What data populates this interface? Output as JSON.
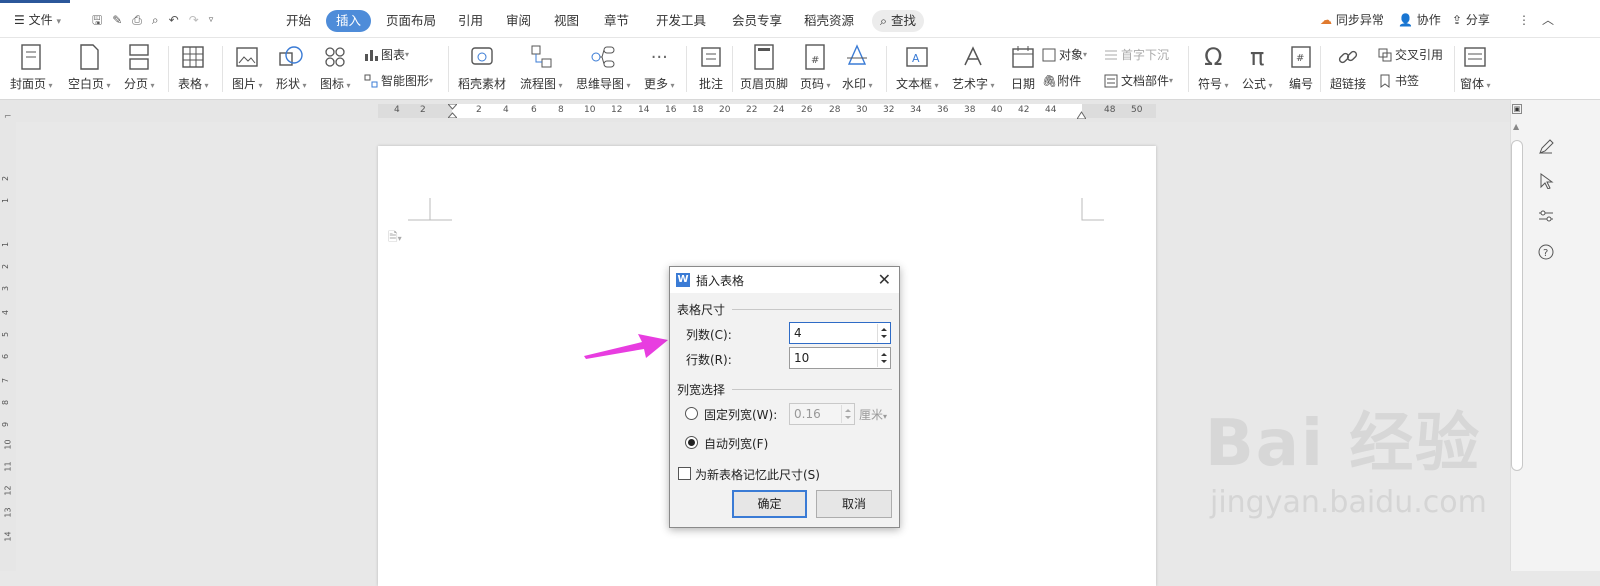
{
  "topbar": {
    "file_menu": "文件",
    "tabs": [
      "开始",
      "插入",
      "页面布局",
      "引用",
      "审阅",
      "视图",
      "章节",
      "开发工具",
      "会员专享",
      "稻壳资源"
    ],
    "search": "查找",
    "right": {
      "sync": "同步异常",
      "collab": "协作",
      "share": "分享"
    }
  },
  "ribbon": {
    "cover": "封面页",
    "blank": "空白页",
    "page_break": "分页",
    "table": "表格",
    "picture": "图片",
    "shape": "形状",
    "icon": "图标",
    "chart": "图表",
    "smart_art": "智能图形",
    "docer": "稻壳素材",
    "flowchart": "流程图",
    "mindmap": "思维导图",
    "more": "更多",
    "comment": "批注",
    "header_footer": "页眉页脚",
    "page_number": "页码",
    "watermark": "水印",
    "textbox": "文本框",
    "wordart": "艺术字",
    "date": "日期",
    "object": "对象",
    "dropcap": "首字下沉",
    "attachment": "附件",
    "doc_parts": "文档部件",
    "symbol": "符号",
    "formula": "公式",
    "numbering": "编号",
    "hyperlink": "超链接",
    "crossref": "交叉引用",
    "bookmark": "书签",
    "window": "窗体"
  },
  "ruler": {
    "h_numbers": [
      "4",
      "2",
      "2",
      "4",
      "6",
      "8",
      "10",
      "12",
      "14",
      "16",
      "18",
      "20",
      "22",
      "24",
      "26",
      "28",
      "30",
      "32",
      "34",
      "36",
      "38",
      "40",
      "42",
      "44",
      "48",
      "50"
    ],
    "v_numbers": [
      "2",
      "1",
      "1",
      "2",
      "3",
      "4",
      "5",
      "6",
      "7",
      "8",
      "9",
      "10",
      "11",
      "12",
      "13",
      "14"
    ]
  },
  "dialog": {
    "title": "插入表格",
    "size_group": "表格尺寸",
    "cols_label": "列数(C):",
    "cols_value": "4",
    "rows_label": "行数(R):",
    "rows_value": "10",
    "width_group": "列宽选择",
    "fixed_label": "固定列宽(W):",
    "fixed_value": "0.16",
    "fixed_unit": "厘米",
    "auto_label": "自动列宽(F)",
    "remember_label": "为新表格记忆此尺寸(S)",
    "ok": "确定",
    "cancel": "取消"
  },
  "watermark": {
    "line1": "Bai 经验",
    "line2": "jingyan.baidu.com"
  },
  "colors": {
    "accent": "#4e8cd9",
    "arrow": "#e83de0"
  }
}
